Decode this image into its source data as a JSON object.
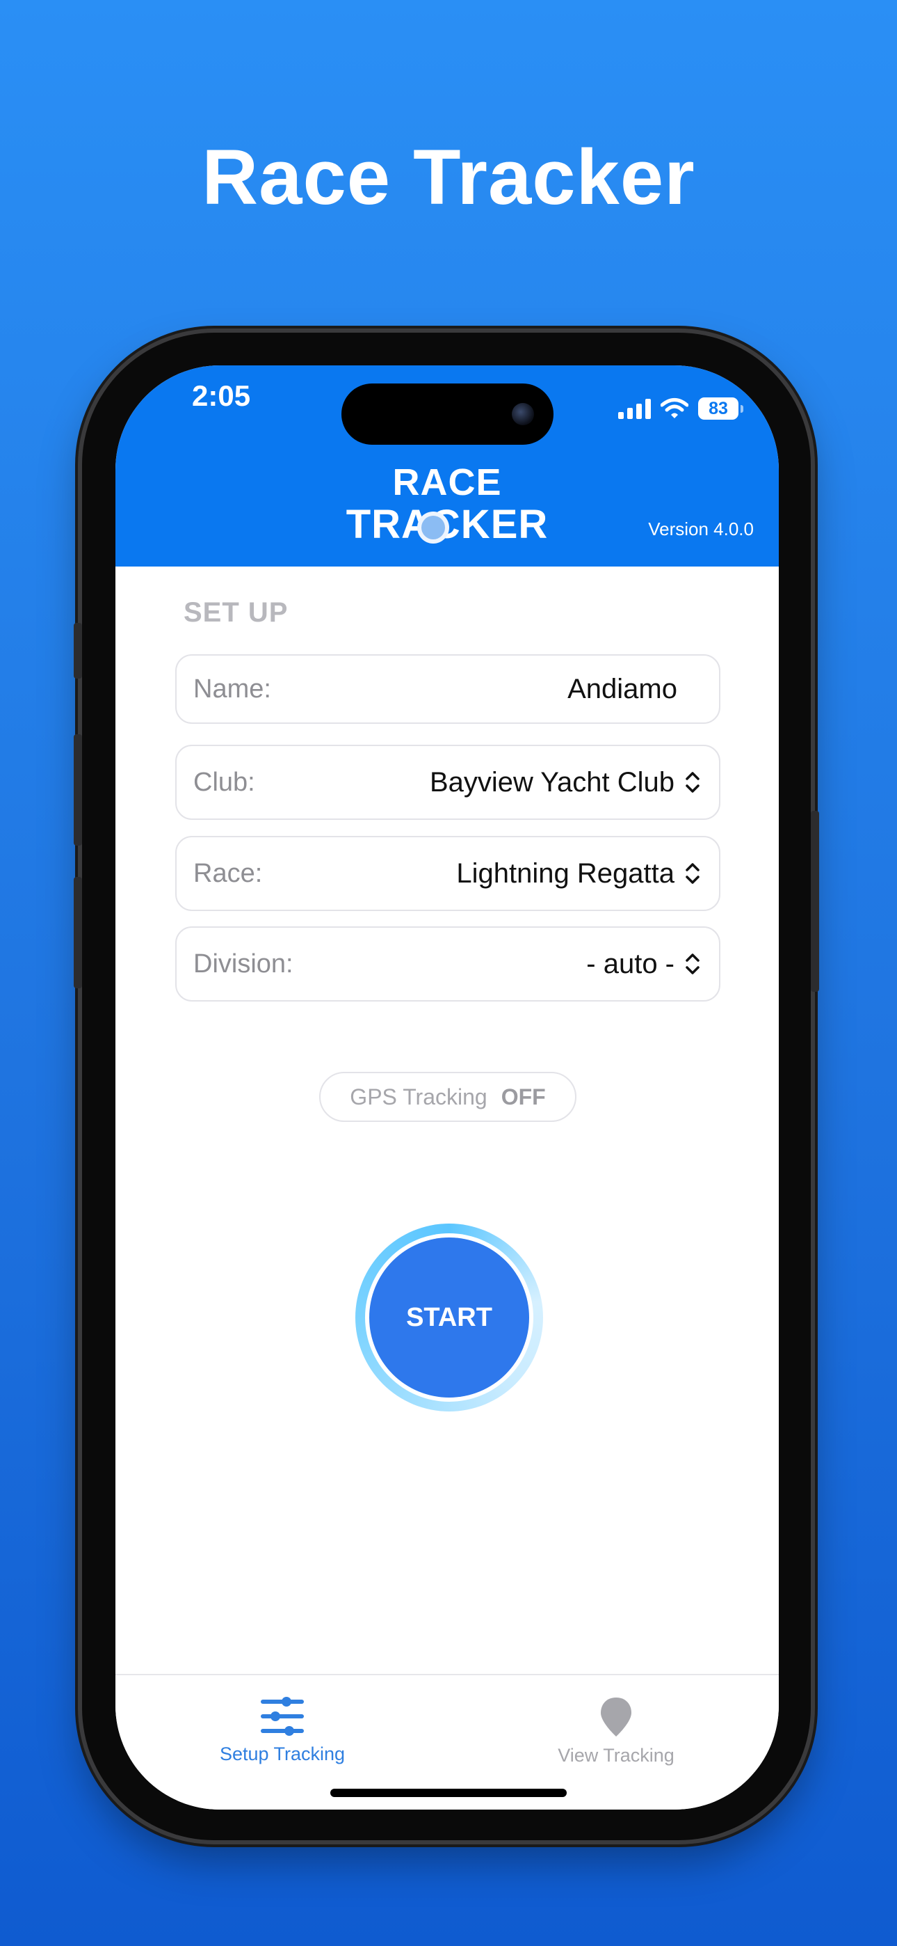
{
  "hero": {
    "title": "Race Tracker"
  },
  "status_bar": {
    "time": "2:05",
    "battery": "83"
  },
  "header": {
    "logo_line1": "RACE",
    "logo_line2": "TRACKER",
    "version": "Version 4.0.0"
  },
  "setup": {
    "section_title": "SET UP",
    "fields": [
      {
        "label": "Name:",
        "value": "Andiamo"
      },
      {
        "label": "Club:",
        "value": "Bayview Yacht Club"
      },
      {
        "label": "Race:",
        "value": "Lightning Regatta"
      },
      {
        "label": "Division:",
        "value": "- auto -"
      }
    ]
  },
  "gps": {
    "label": "GPS Tracking",
    "state": "OFF"
  },
  "start_button": {
    "label": "START"
  },
  "tabs": [
    {
      "label": "Setup Tracking",
      "icon": "sliders-icon",
      "active": true
    },
    {
      "label": "View Tracking",
      "icon": "map-pin-icon",
      "active": false
    }
  ],
  "colors": {
    "accent": "#0a78f0",
    "start": "#2e78ec",
    "tab_active": "#2f7fe0",
    "tab_inactive": "#a6a6ab"
  }
}
